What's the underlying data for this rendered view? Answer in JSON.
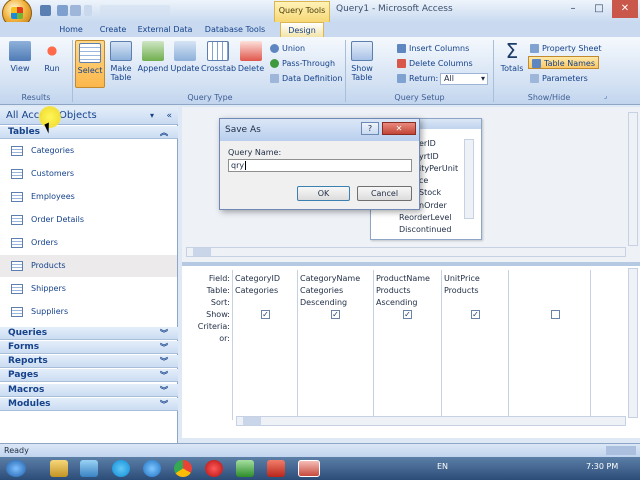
{
  "window": {
    "title": "Query1 - Microsoft Access",
    "context_tab": "Query Tools",
    "controls": {
      "minimize": "–",
      "maximize": "□",
      "close": "✕"
    }
  },
  "tabs": [
    {
      "label": "Home"
    },
    {
      "label": "Create"
    },
    {
      "label": "External Data"
    },
    {
      "label": "Database Tools"
    },
    {
      "label": "Design"
    }
  ],
  "ribbon": {
    "groups": {
      "results": "Results",
      "query_type": "Query Type",
      "query_setup": "Query Setup",
      "show_hide": "Show/Hide"
    },
    "buttons": {
      "view": "View",
      "run": "Run",
      "select": "Select",
      "make_table_1": "Make",
      "make_table_2": "Table",
      "append": "Append",
      "update": "Update",
      "crosstab": "Crosstab",
      "delete": "Delete",
      "union": "Union",
      "pass_through": "Pass-Through",
      "data_definition": "Data Definition",
      "show_table_1": "Show",
      "show_table_2": "Table",
      "insert_columns": "Insert Columns",
      "delete_columns": "Delete Columns",
      "return_label": "Return:",
      "return_value": "All",
      "totals": "Totals",
      "property_sheet": "Property Sheet",
      "table_names": "Table Names",
      "parameters": "Parameters"
    }
  },
  "nav": {
    "header": "All Access Objects",
    "tables_label": "Tables",
    "tables": [
      "Categories",
      "Customers",
      "Employees",
      "Order Details",
      "Orders",
      "Products",
      "Shippers",
      "Suppliers"
    ],
    "sections": [
      "Queries",
      "Forms",
      "Reports",
      "Pages",
      "Macros",
      "Modules"
    ]
  },
  "field_list": {
    "fields": [
      "erID",
      "yrtID",
      "ityPerUnit",
      "ce",
      "Stock",
      "nOrder",
      "ReorderLevel",
      "Discontinued"
    ]
  },
  "grid": {
    "row_labels": [
      "Field:",
      "Table:",
      "Sort:",
      "Show:",
      "Criteria:",
      "or:"
    ],
    "columns": [
      {
        "field": "CategoryID",
        "table": "Categories",
        "sort": "",
        "show": true
      },
      {
        "field": "CategoryName",
        "table": "Categories",
        "sort": "Descending",
        "show": true
      },
      {
        "field": "ProductName",
        "table": "Products",
        "sort": "Ascending",
        "show": true
      },
      {
        "field": "UnitPrice",
        "table": "Products",
        "sort": "",
        "show": true
      },
      {
        "field": "",
        "table": "",
        "sort": "",
        "show": false
      }
    ]
  },
  "dialog": {
    "title": "Save As",
    "help": "?",
    "close": "✕",
    "label": "Query Name:",
    "value": "qry",
    "ok": "OK",
    "cancel": "Cancel"
  },
  "status": {
    "text": "Ready"
  },
  "taskbar": {
    "language": "EN",
    "time": "7:30 PM"
  },
  "colors": {
    "ribbon_accent": "#fbb74a",
    "title_gradient_top": "#eef4fb",
    "nav_text": "#15428b"
  }
}
